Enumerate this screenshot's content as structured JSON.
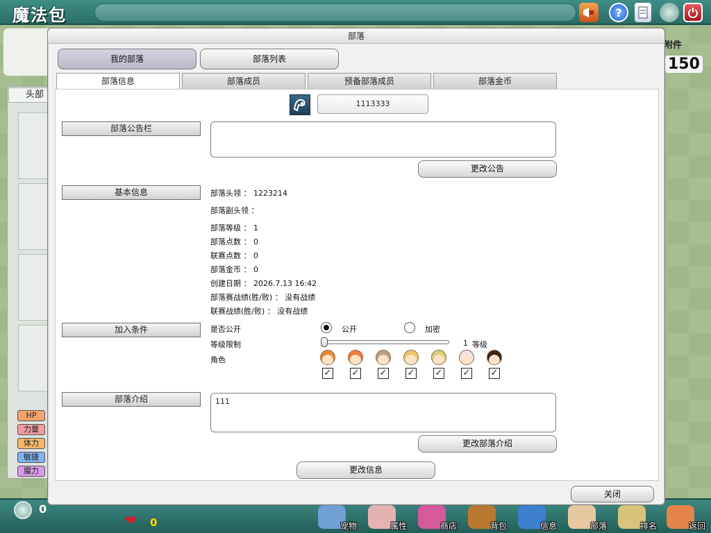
{
  "app": {
    "title": "魔法包"
  },
  "background": {
    "left_tab": "头部",
    "right_label": "附件",
    "right_number": "150",
    "stats": [
      {
        "label": "HP",
        "color": "#f3a36b"
      },
      {
        "label": "力量",
        "color": "#f19aa0"
      },
      {
        "label": "体力",
        "color": "#f4b66a"
      },
      {
        "label": "敏捷",
        "color": "#7fb2ef"
      },
      {
        "label": "魔力",
        "color": "#d59be6"
      }
    ]
  },
  "bottom_bar": {
    "coin_count": "0",
    "heart_count": "0",
    "nav": [
      {
        "label": "宠物",
        "color": "#6f9fd4"
      },
      {
        "label": "属性",
        "color": "#e5b2b2"
      },
      {
        "label": "商店",
        "color": "#d45a9c"
      },
      {
        "label": "背包",
        "color": "#b9782f"
      },
      {
        "label": "信息",
        "color": "#3f7fd0"
      },
      {
        "label": "部落",
        "color": "#e6c9a0"
      },
      {
        "label": "排名",
        "color": "#d8c37a"
      },
      {
        "label": "返回",
        "color": "#e4844b"
      }
    ]
  },
  "dialog": {
    "title": "部落",
    "top_tabs": [
      "我的部落",
      "部落列表"
    ],
    "tabs": [
      "部落信息",
      "部落成员",
      "预备部落成员",
      "部落金币"
    ],
    "clan_id": "1113333",
    "notice": {
      "label": "部落公告栏",
      "text": "",
      "edit_button": "更改公告"
    },
    "basic": {
      "label": "基本信息",
      "lines": [
        "部落头领 ： 1223214",
        "部落副头领 ：",
        "部落等级 ： 1",
        "部落点数 ： 0",
        "联赛点数 ： 0",
        "部落金币 ： 0",
        "创建日期 ： 2026.7.13 16:42",
        "部落赛战绩(胜/败) ： 没有战绩",
        "联赛战绩(胜/败) ： 没有战绩"
      ]
    },
    "join": {
      "label": "加入条件",
      "public_label": "是否公开",
      "option_public": "公开",
      "option_private": "加密",
      "selected": "public",
      "level_label": "等级限制",
      "level_value": "1",
      "level_unit": "等级",
      "level_fraction": 0.0,
      "role_label": "角色",
      "roles": [
        {
          "hair": "#e78a3c",
          "checked": true
        },
        {
          "hair": "#ef7b3c",
          "checked": true
        },
        {
          "hair": "#b9a08a",
          "checked": true
        },
        {
          "hair": "#f1c76c",
          "checked": true
        },
        {
          "hair": "#d8d07a",
          "checked": true
        },
        {
          "hair": "#f0e0e6",
          "checked": true
        },
        {
          "hair": "#3a2418",
          "checked": true
        }
      ]
    },
    "intro": {
      "label": "部落介绍",
      "text": "111",
      "edit_button": "更改部落介绍"
    },
    "update_button": "更改信息",
    "close_button": "关闭"
  }
}
